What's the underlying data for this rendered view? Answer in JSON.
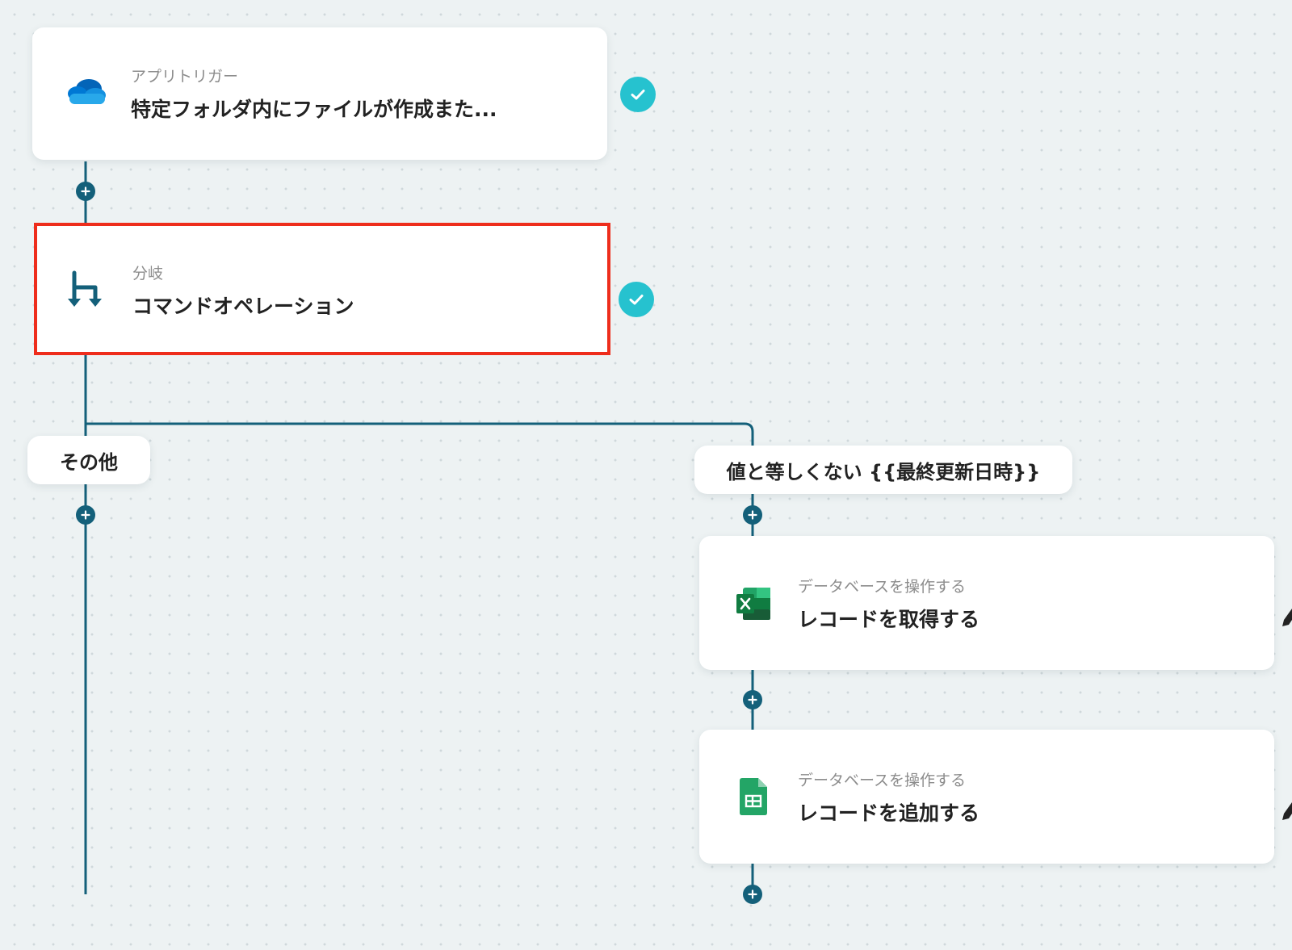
{
  "flow": {
    "trigger": {
      "icon": "onedrive-cloud-icon",
      "subtitle": "アプリトリガー",
      "title": "特定フォルダ内にファイルが作成また..."
    },
    "branch": {
      "icon": "branch-icon",
      "subtitle": "分岐",
      "title": "コマンドオペレーション"
    },
    "branch_labels": {
      "other": "その他",
      "condition": "値と等しくない {{最終更新日時}}"
    },
    "actions": [
      {
        "icon": "excel-icon",
        "subtitle": "データベースを操作する",
        "title": "レコードを取得する"
      },
      {
        "icon": "google-sheets-icon",
        "subtitle": "データベースを操作する",
        "title": "レコードを追加する"
      }
    ]
  },
  "colors": {
    "connector": "#14607a",
    "check": "#26c2cf",
    "selected_border": "#ee2d1c",
    "background": "#edf2f3"
  }
}
